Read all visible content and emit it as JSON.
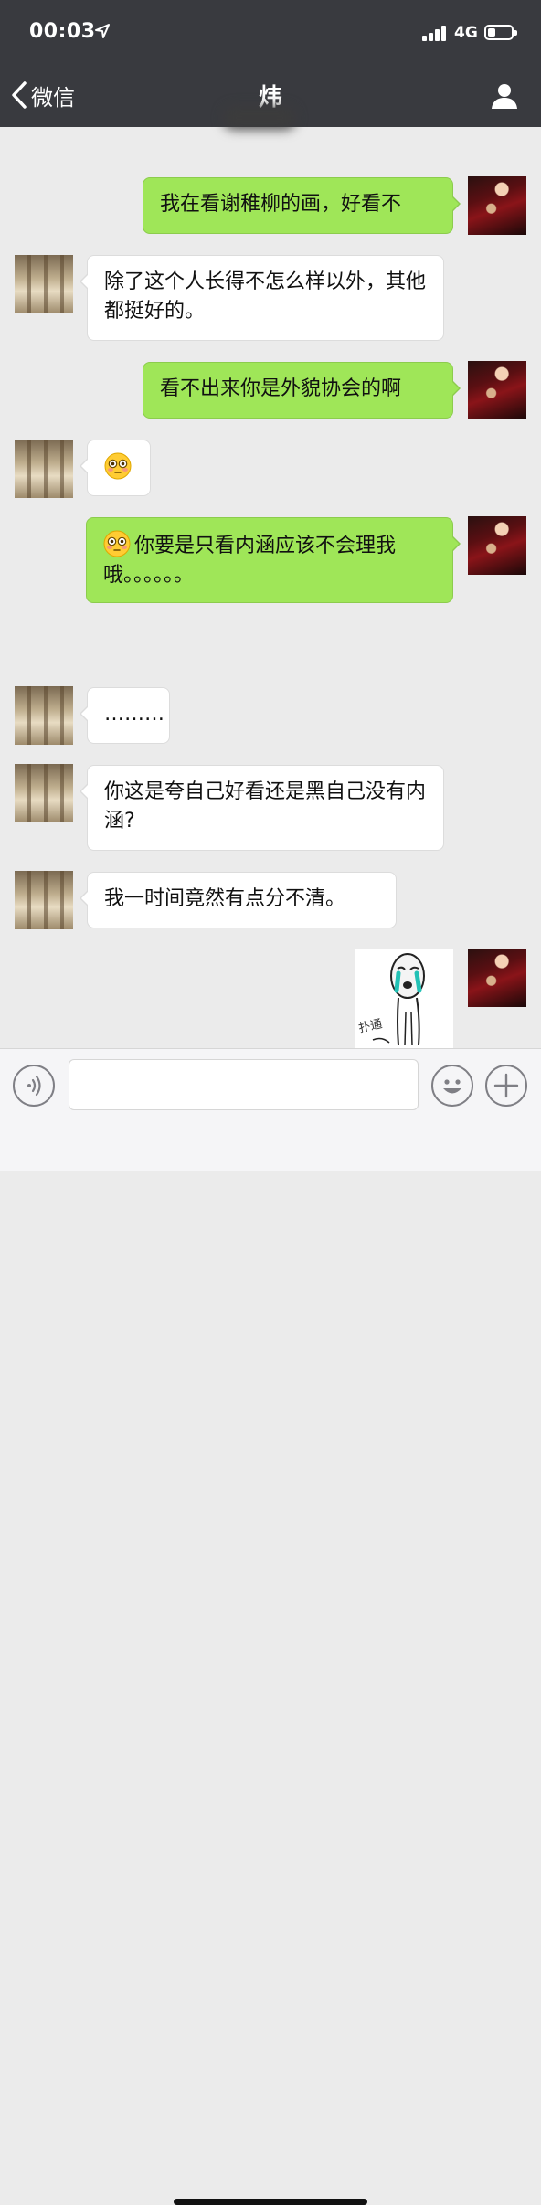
{
  "status_bar": {
    "time": "00:03",
    "network": "4G"
  },
  "header": {
    "back_label": "微信",
    "title": "炜"
  },
  "messages": [
    {
      "side": "out",
      "text": "我在看谢稚柳的画，好看不"
    },
    {
      "side": "in",
      "text": "除了这个人长得不怎么样以外，其他都挺好的。"
    },
    {
      "side": "out",
      "text": "看不出来你是外貌协会的啊"
    },
    {
      "side": "in",
      "emoji": "flushed-face",
      "text": ""
    },
    {
      "side": "out",
      "emoji": "flushed-face",
      "text": "你要是只看内涵应该不会理我哦。。。。。。"
    },
    {
      "side": "in",
      "text": "………"
    },
    {
      "side": "in",
      "text": "你这是夸自己好看还是黑自己没有内涵?"
    },
    {
      "side": "in",
      "text": "我一时间竟然有点分不清。"
    },
    {
      "side": "out",
      "sticker": "crying-meme-sticker",
      "text": "扑通"
    }
  ],
  "input_bar": {
    "placeholder": ""
  },
  "colors": {
    "header_bg": "#393a3f",
    "chat_bg": "#ebebeb",
    "out_bubble": "#9fe658",
    "in_bubble": "#ffffff"
  }
}
